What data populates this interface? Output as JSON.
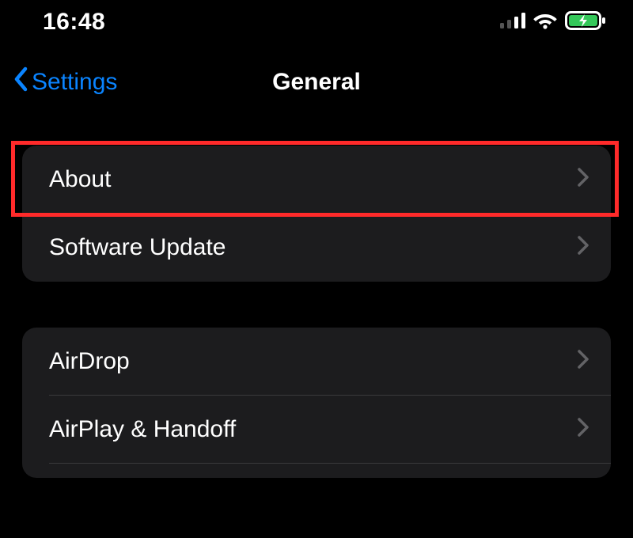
{
  "statusBar": {
    "time": "16:48"
  },
  "nav": {
    "backLabel": "Settings",
    "title": "General"
  },
  "groups": [
    {
      "rows": [
        {
          "label": "About",
          "highlighted": true
        },
        {
          "label": "Software Update"
        }
      ]
    },
    {
      "rows": [
        {
          "label": "AirDrop"
        },
        {
          "label": "AirPlay & Handoff"
        }
      ]
    }
  ],
  "colors": {
    "accent": "#0a84ff",
    "highlight": "#ff2a2a"
  }
}
